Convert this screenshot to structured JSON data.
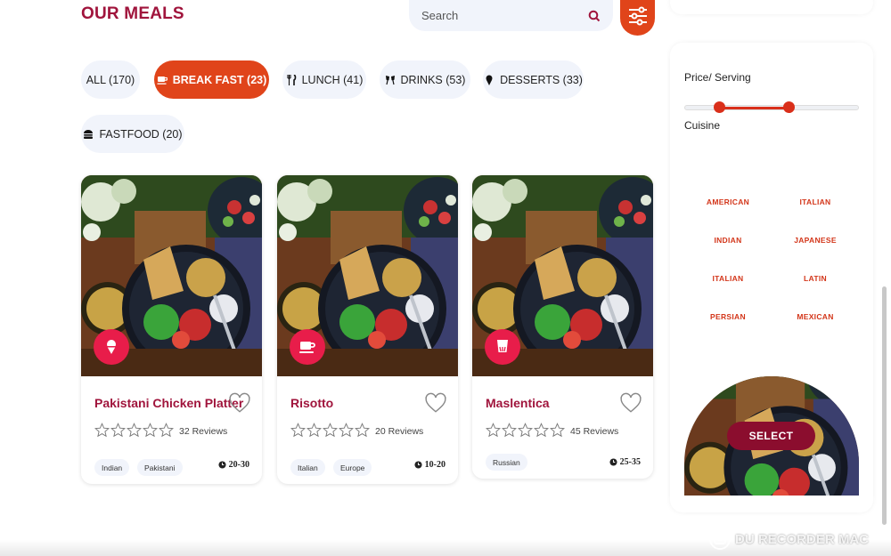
{
  "header": {
    "title": "OUR MEALS",
    "search_placeholder": "Search"
  },
  "categories": [
    {
      "label": "ALL (170)",
      "active": false,
      "icon": "none"
    },
    {
      "label": "BREAK FAST (23)",
      "active": true,
      "icon": "coffee-cup-icon"
    },
    {
      "label": "LUNCH (41)",
      "active": false,
      "icon": "fork-knife-icon"
    },
    {
      "label": "DRINKS (53)",
      "active": false,
      "icon": "glasses-cheers-icon"
    },
    {
      "label": "DESSERTS (33)",
      "active": false,
      "icon": "ice-cream-icon"
    },
    {
      "label": "FASTFOOD (20)",
      "active": false,
      "icon": "burger-icon"
    }
  ],
  "meals": [
    {
      "name": "Pakistani Chicken Platter",
      "reviews": "32 Reviews",
      "rating": 0,
      "tags": [
        "Indian",
        "Pakistani"
      ],
      "time": "20-30",
      "badge_icon": "ice-cream-icon"
    },
    {
      "name": "Risotto",
      "reviews": "20 Reviews",
      "rating": 0,
      "tags": [
        "Italian",
        "Europe"
      ],
      "time": "10-20",
      "badge_icon": "coffee-cup-icon"
    },
    {
      "name": "Maslentica",
      "reviews": "45 Reviews",
      "rating": 0,
      "tags": [
        "Russian"
      ],
      "time": "25-35",
      "badge_icon": "drink-glass-icon"
    }
  ],
  "sidebar": {
    "price_label": "Price/ Serving",
    "price_range_fraction": [
      0.2,
      0.6
    ],
    "cuisine_label": "Cuisine",
    "cuisines": [
      "AMERICAN",
      "ITALIAN",
      "INDIAN",
      "JAPANESE",
      "ITALIAN",
      "LATIN",
      "PERSIAN",
      "MEXICAN"
    ],
    "select_label": "SELECT"
  },
  "watermark": "DU RECORDER MAC",
  "colors": {
    "accent": "#e0441a",
    "brand": "#a0143c",
    "badge": "#e81d4a",
    "chip_bg": "#f1f4fb",
    "select_btn": "#8b0d2e"
  }
}
